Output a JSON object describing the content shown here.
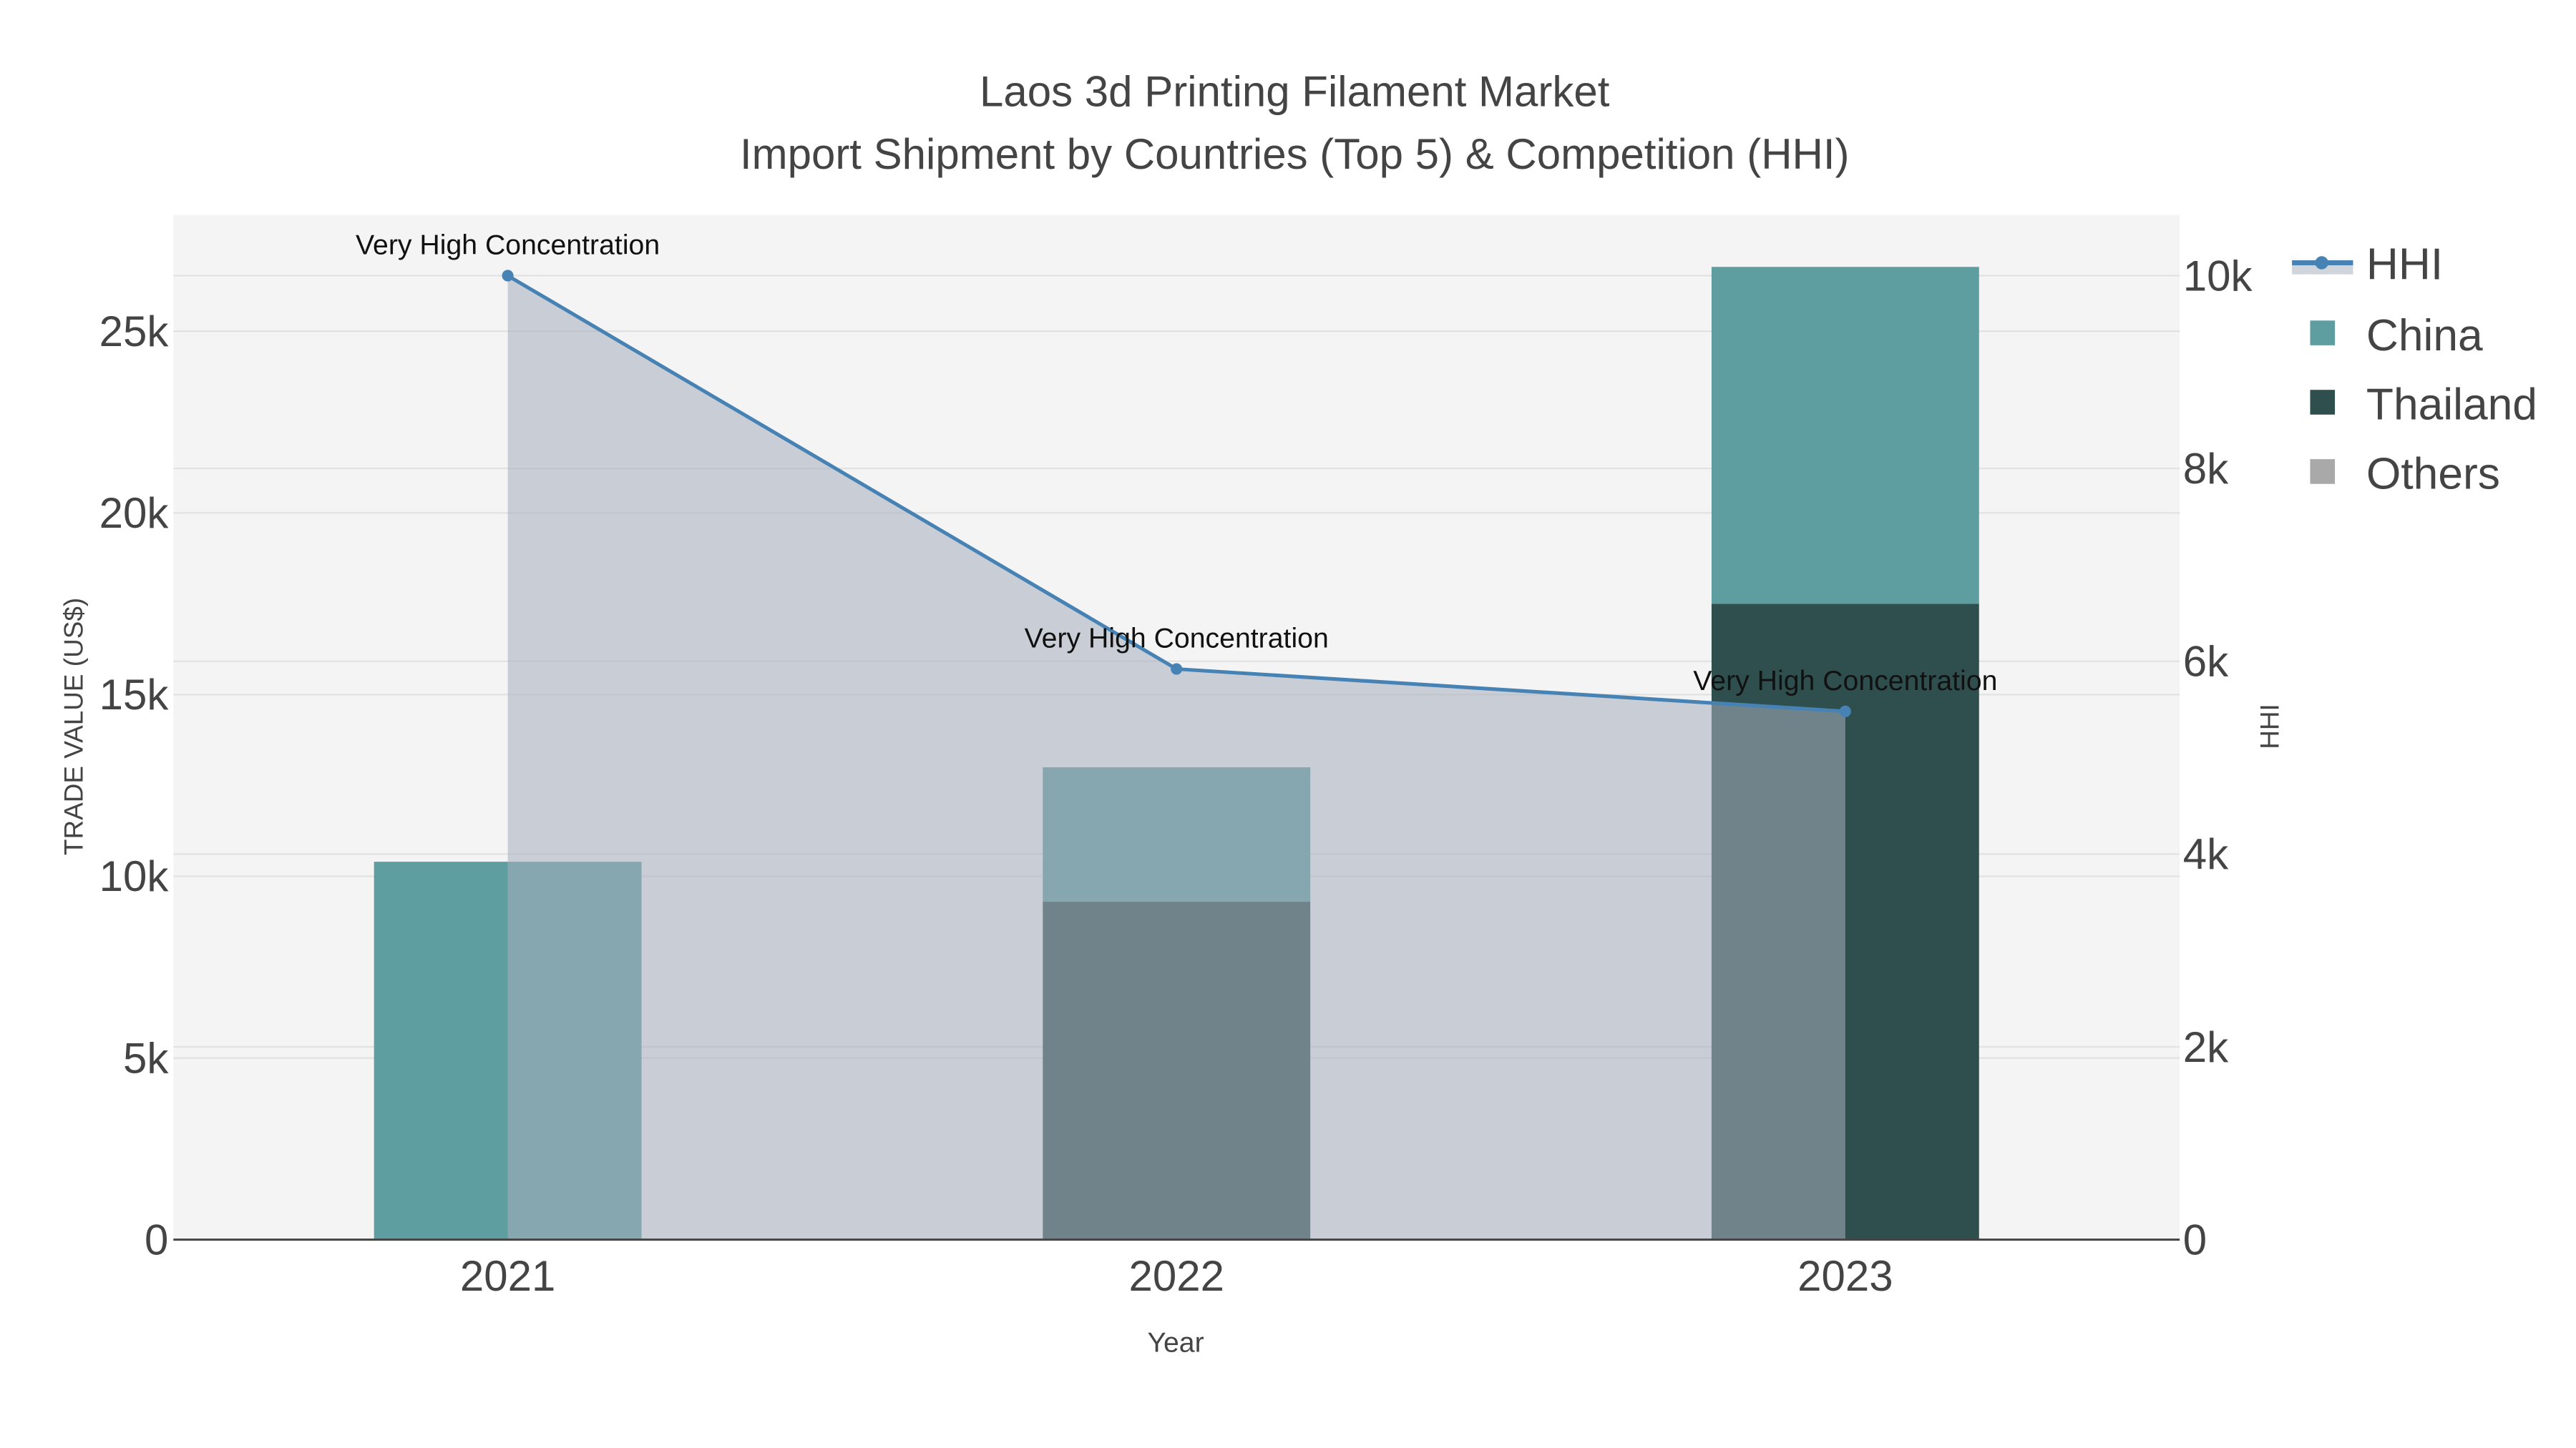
{
  "chart_data": {
    "type": "bar",
    "title_line1": "Laos 3d Printing Filament Market",
    "title_line2": "Import Shipment by Countries (Top 5) & Competition (HHI)",
    "xlabel": "Year",
    "ylabel": "TRADE VALUE (US$)",
    "y2label": "HHI",
    "categories": [
      "2021",
      "2022",
      "2023"
    ],
    "ylim": [
      0,
      28200
    ],
    "y2lim": [
      0,
      10630
    ],
    "yticks": [
      {
        "v": 0,
        "label": "0"
      },
      {
        "v": 5000,
        "label": "5k"
      },
      {
        "v": 10000,
        "label": "10k"
      },
      {
        "v": 15000,
        "label": "15k"
      },
      {
        "v": 20000,
        "label": "20k"
      },
      {
        "v": 25000,
        "label": "25k"
      }
    ],
    "y2ticks": [
      {
        "v": 0,
        "label": "0"
      },
      {
        "v": 2000,
        "label": "2k"
      },
      {
        "v": 4000,
        "label": "4k"
      },
      {
        "v": 6000,
        "label": "6k"
      },
      {
        "v": 8000,
        "label": "8k"
      },
      {
        "v": 10000,
        "label": "10k"
      }
    ],
    "series": [
      {
        "name": "Thailand",
        "color": "#2f4f4f",
        "values": [
          0,
          9300,
          17500
        ]
      },
      {
        "name": "China",
        "color": "#5f9ea0",
        "values": [
          10400,
          3700,
          9270
        ]
      },
      {
        "name": "Others",
        "color": "#a9a9a9",
        "values": [
          0,
          0,
          0
        ]
      }
    ],
    "hhi": {
      "name": "HHI",
      "color": "#4682b4",
      "fill": "rgba(165,174,190,0.55)",
      "values": [
        10000,
        5920,
        5480
      ],
      "annotations": [
        "Very High Concentration",
        "Very High Concentration",
        "Very High Concentration"
      ]
    },
    "legend": [
      "HHI",
      "China",
      "Thailand",
      "Others"
    ],
    "legend_position": "top-right",
    "grid": true
  }
}
